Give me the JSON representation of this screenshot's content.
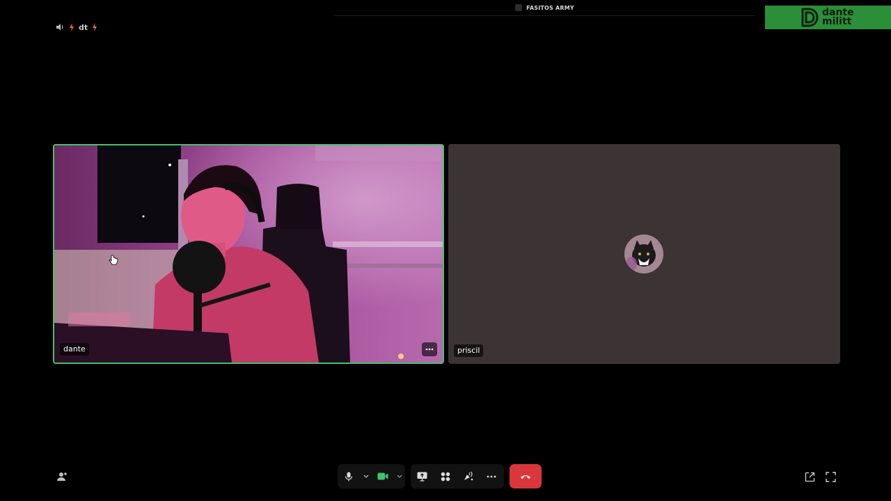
{
  "top_bar": {
    "server_name": "FASITOS ARMY",
    "voice_label": "dt"
  },
  "brand": {
    "line1": "dante",
    "line2": "militt"
  },
  "tiles": [
    {
      "name": "dante",
      "speaking": true
    },
    {
      "name": "priscil",
      "speaking": false
    }
  ],
  "colors": {
    "speaking_border": "#3ec46d",
    "hangup": "#da373c",
    "camera_on": "#3ec46d",
    "brand_bg": "#2b8f3a"
  },
  "icons": {
    "top_left": [
      "speaker-icon",
      "lightning-icon",
      "lightning-icon"
    ],
    "controls": [
      "microphone-icon",
      "chevron-down-icon",
      "camera-icon",
      "chevron-down-icon",
      "screen-share-icon",
      "activities-icon",
      "soundboard-icon",
      "more-icon",
      "hangup-icon"
    ],
    "right": [
      "popout-icon",
      "fullscreen-icon"
    ],
    "left": [
      "invite-icon"
    ]
  }
}
